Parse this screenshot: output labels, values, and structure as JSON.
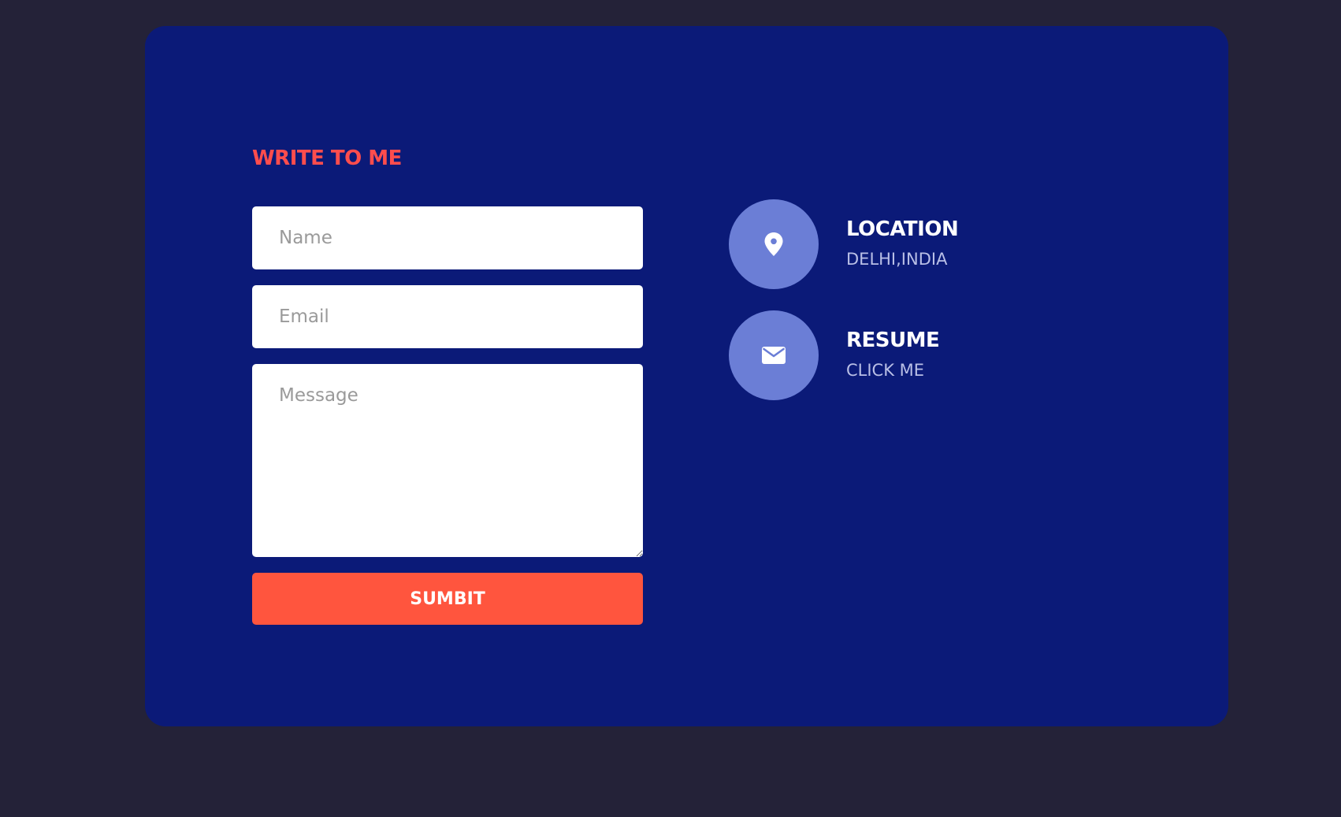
{
  "contact_form": {
    "heading": "WRITE TO ME",
    "name_placeholder": "Name",
    "email_placeholder": "Email",
    "message_placeholder": "Message",
    "submit_label": "SUMBIT"
  },
  "info": {
    "location": {
      "icon": "map-pin-icon",
      "title": "LOCATION",
      "value": "DELHI,INDIA"
    },
    "resume": {
      "icon": "envelope-icon",
      "title": "RESUME",
      "value": "CLICK ME"
    }
  },
  "colors": {
    "page_background": "#242238",
    "card_background": "#0b1a78",
    "heading_accent": "#ff4d4d",
    "submit_button": "#ff553e",
    "icon_circle": "#6b7ed6"
  }
}
